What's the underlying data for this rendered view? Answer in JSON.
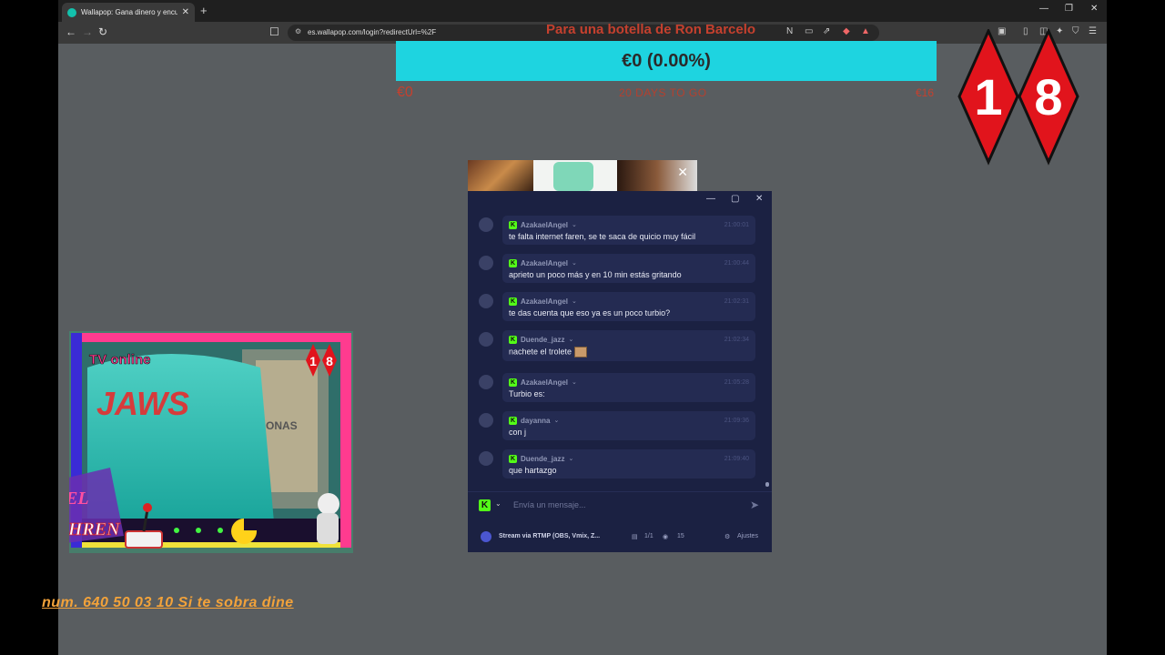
{
  "browser": {
    "tab_title": "Wallapop: Gana dinero y encuen",
    "tab_close": "✕",
    "new_tab": "+",
    "url": "es.wallapop.com/login?redirectUrl=%2F",
    "window_controls": [
      "—",
      "❐",
      "✕"
    ]
  },
  "goal": {
    "title": "Para una botella de Ron Barcelo",
    "progress_text": "€0 (0.00%)",
    "progress_fraction": 0.0,
    "min_label": "€0",
    "days_label": "20 DAYS TO GO",
    "max_label": "€16"
  },
  "age_badge": {
    "digits": [
      "1",
      "8"
    ]
  },
  "popup": {
    "close": "✕"
  },
  "chat": {
    "window_controls": [
      "—",
      "▢",
      "✕"
    ],
    "messages": [
      {
        "user": "AzakaelAngel",
        "time": "21:00:01",
        "text": "te falta internet faren, se te saca de quicio muy fácil"
      },
      {
        "user": "AzakaelAngel",
        "time": "21:00:44",
        "text": "aprieto un poco más y en 10 min estás gritando"
      },
      {
        "user": "AzakaelAngel",
        "time": "21:02:31",
        "text": "te das cuenta que eso ya es un poco turbio?"
      },
      {
        "user": "Duende_jazz",
        "time": "21:02:34",
        "text": "nachete el trolete"
      },
      {
        "user": "AzakaelAngel",
        "time": "21:05:28",
        "text": "Turbio es:"
      },
      {
        "user": "dayanna",
        "time": "21:09:36",
        "text": "con j"
      },
      {
        "user": "Duende_jazz",
        "time": "21:09:40",
        "text": "que hartazgo"
      }
    ],
    "input_placeholder": "Envía un mensaje...",
    "footer_stream": "Stream via RTMP (OBS, Vmix, Z...",
    "footer_viewers_slots": "1/1",
    "footer_viewers": "15",
    "footer_settings": "Ajustes"
  },
  "webcam": {
    "tv_label": "TV online",
    "shirt_text": "JAWS",
    "poster_text": "ONAS",
    "mini_badge": [
      "1",
      "8"
    ],
    "logo_line1": "EL",
    "logo_line2": "FAHREN"
  },
  "ticker": "num. 640 50 03 10 Si te sobra dine",
  "colors": {
    "goal_bar": "#1ed4e0",
    "goal_text": "#c5402e",
    "page_bg": "#595d60",
    "chat_bg": "#1b2142",
    "kick_green": "#53fc18",
    "badge_red": "#e1141c"
  }
}
